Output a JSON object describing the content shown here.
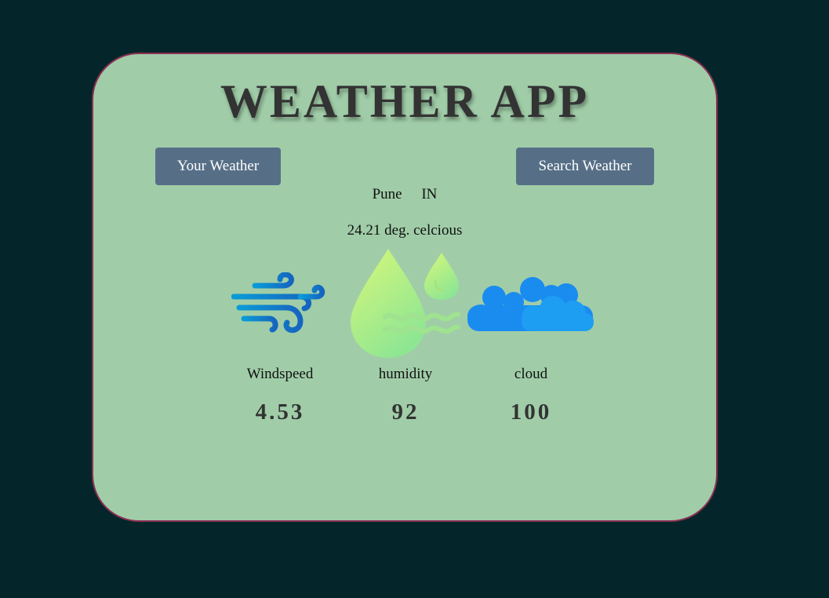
{
  "app": {
    "title": "WEATHER APP"
  },
  "tabs": {
    "your_weather": "Your Weather",
    "search_weather": "Search Weather"
  },
  "location": {
    "city": "Pune",
    "country": "IN"
  },
  "temperature": "24.21 deg. celcious",
  "stats": {
    "windspeed": {
      "label": "Windspeed",
      "value": "4.53",
      "icon": "wind-icon"
    },
    "humidity": {
      "label": "humidity",
      "value": "92",
      "icon": "humidity-icon"
    },
    "cloud": {
      "label": "cloud",
      "value": "100",
      "icon": "cloud-icon"
    }
  },
  "colors": {
    "background": "#04262a",
    "card": "#a0cda8",
    "card_border": "#8b2f52",
    "button": "#566f87",
    "title_text": "#333333"
  }
}
